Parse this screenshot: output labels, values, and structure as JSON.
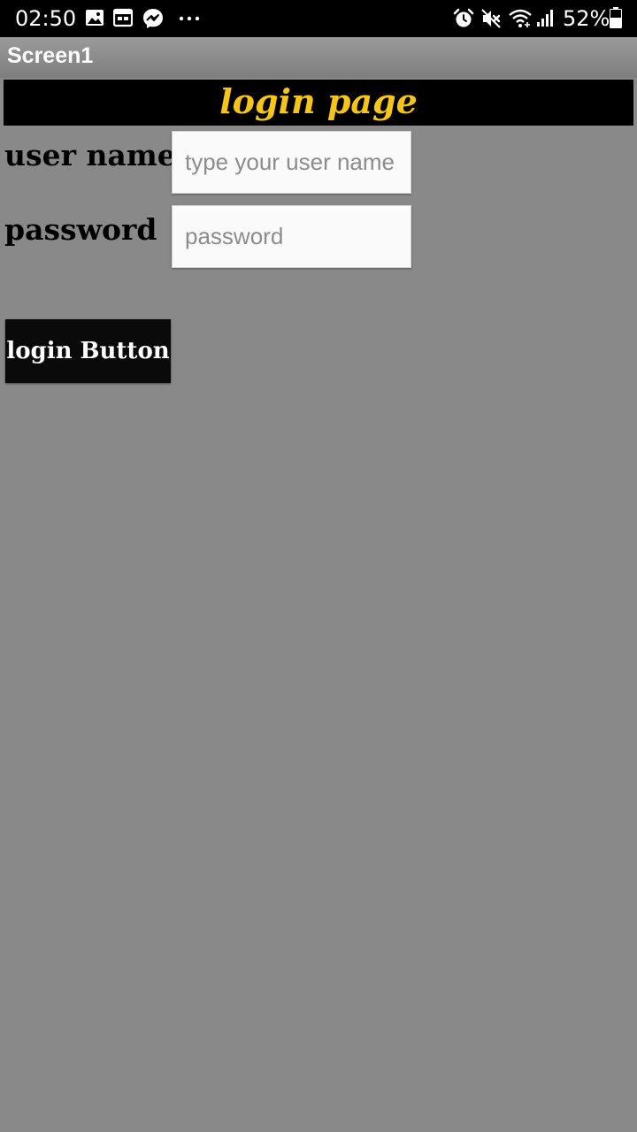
{
  "status_bar": {
    "time": "02:50",
    "battery_percent": "52%",
    "icons": [
      "image-icon",
      "calendar-icon",
      "messenger-icon",
      "more-dots-icon",
      "alarm-icon",
      "mute-icon",
      "wifi-icon",
      "signal-icon",
      "battery-icon"
    ]
  },
  "app": {
    "title": "Screen1"
  },
  "banner": {
    "heading": "login page",
    "text_color": "#f5c518",
    "background": "#000000"
  },
  "form": {
    "username_label": "user name",
    "username_placeholder": "type your user name",
    "username_value": "",
    "password_label": "password",
    "password_placeholder": "password",
    "password_value": "",
    "login_button": "login Button"
  },
  "colors": {
    "screen_background": "#898989",
    "button_background": "#0a0a0a"
  }
}
